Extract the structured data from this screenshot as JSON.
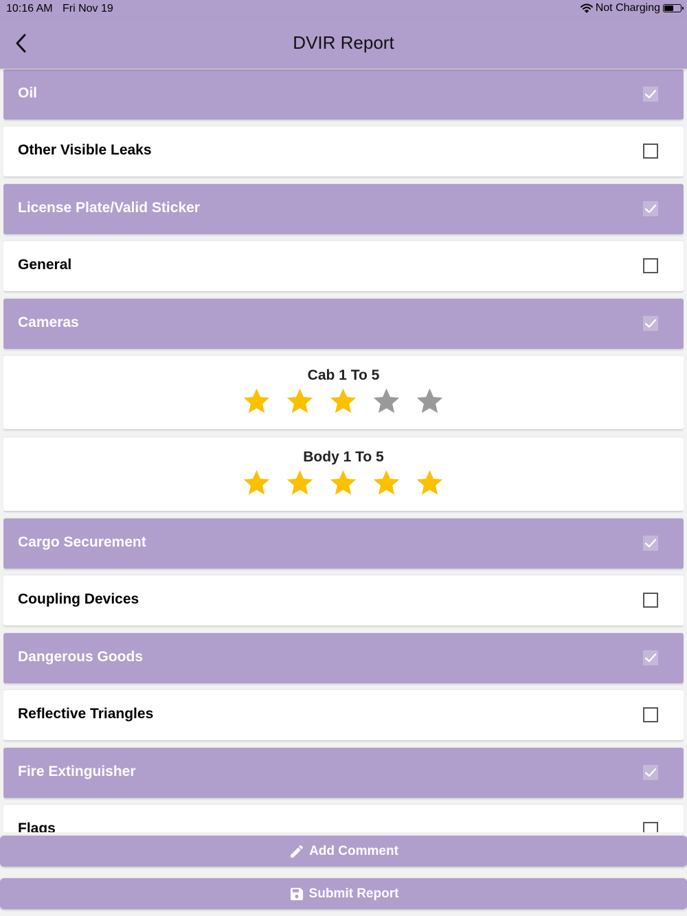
{
  "status_bar": {
    "time": "10:16 AM",
    "date": "Fri Nov 19",
    "charging": "Not Charging",
    "battery_level": 0.6
  },
  "header": {
    "title": "DVIR Report",
    "back_icon": "chevron-left-icon"
  },
  "items": [
    {
      "label": "Oil",
      "checked": true
    },
    {
      "label": "Other Visible Leaks",
      "checked": false
    },
    {
      "label": "License Plate/Valid Sticker",
      "checked": true
    },
    {
      "label": "General",
      "checked": false
    },
    {
      "label": "Cameras",
      "checked": true
    },
    {
      "label": "Cargo Securement",
      "checked": true
    },
    {
      "label": "Coupling Devices",
      "checked": false
    },
    {
      "label": "Dangerous Goods",
      "checked": true
    },
    {
      "label": "Reflective Triangles",
      "checked": false
    },
    {
      "label": "Fire Extinguisher",
      "checked": true
    },
    {
      "label": "Flags",
      "checked": false
    }
  ],
  "ratings": [
    {
      "title": "Cab 1 To 5",
      "value": 3,
      "max": 5
    },
    {
      "title": "Body 1 To 5",
      "value": 5,
      "max": 5
    }
  ],
  "buttons": {
    "add_comment": "Add Comment",
    "submit_report": "Submit Report"
  },
  "colors": {
    "accent": "#b09fcc",
    "star_filled": "#fbc002",
    "star_empty": "#9a9a9a"
  }
}
